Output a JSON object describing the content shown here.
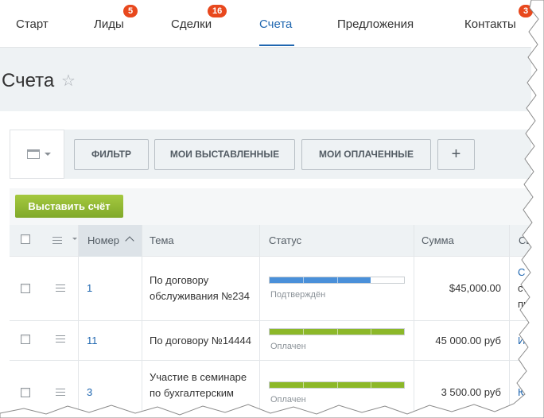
{
  "nav": {
    "tabs": [
      {
        "label": "Старт"
      },
      {
        "label": "Лиды",
        "badge": "5"
      },
      {
        "label": "Сделки",
        "badge": "16"
      },
      {
        "label": "Счета",
        "active": true
      },
      {
        "label": "Предложения"
      },
      {
        "label": "Контакты",
        "badge": "3"
      }
    ]
  },
  "page": {
    "title": "Счета",
    "star_icon": "star-icon"
  },
  "filterbar": {
    "view_icon": "grid-view-icon",
    "filter_label": "ФИЛЬТР",
    "my_issued_label": "МОИ ВЫСТАВЛЕННЫЕ",
    "my_paid_label": "МОИ ОПЛАЧЕННЫЕ",
    "add_label": "+"
  },
  "grid": {
    "create_label": "Выставить счёт",
    "columns": {
      "number": "Номер",
      "topic": "Тема",
      "status": "Статус",
      "sum": "Сумма",
      "extra": "Св"
    },
    "rows": [
      {
        "number": "1",
        "topic_line1": "По договору",
        "topic_line2": "обслуживания №234",
        "status": "Подтверждён",
        "status_color": "#4a90d9",
        "progress": 0.75,
        "sum": "$45,000.00",
        "extra1": "С",
        "extra2": "ст",
        "extra3": "пр"
      },
      {
        "number": "11",
        "topic_line1": "По договору №14444",
        "topic_line2": "",
        "status": "Оплачен",
        "status_color": "#8cb829",
        "progress": 1.0,
        "sum": "45 000.00 руб",
        "extra1": "Ив",
        "extra2": "",
        "extra3": ""
      },
      {
        "number": "3",
        "topic_line1": "Участие в семинаре",
        "topic_line2": "по бухгалтерским",
        "status": "Оплачен",
        "status_color": "#8cb829",
        "progress": 1.0,
        "sum": "3 500.00 руб",
        "extra1": "Ю",
        "extra2": "",
        "extra3": ""
      }
    ]
  }
}
